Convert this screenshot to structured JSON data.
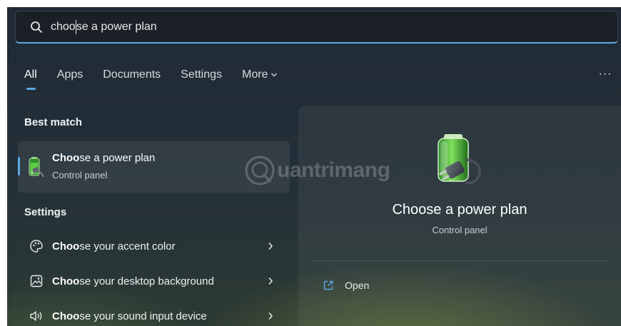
{
  "search": {
    "query_before_caret": "choo",
    "query_after_caret": "se a power plan"
  },
  "tabs": [
    {
      "label": "All",
      "active": true
    },
    {
      "label": "Apps"
    },
    {
      "label": "Documents"
    },
    {
      "label": "Settings"
    },
    {
      "label": "More"
    }
  ],
  "more_options_label": "···",
  "best_match": {
    "section_title": "Best match",
    "item": {
      "title_bold": "Choo",
      "title_rest": "se a power plan",
      "subtitle": "Control panel",
      "icon": "battery-plug-icon"
    }
  },
  "settings": {
    "section_title": "Settings",
    "items": [
      {
        "bold": "Choo",
        "rest": "se your accent color",
        "icon": "palette-icon"
      },
      {
        "bold": "Choo",
        "rest": "se your desktop background",
        "icon": "image-icon"
      },
      {
        "bold": "Choo",
        "rest": "se your sound input device",
        "icon": "speaker-icon"
      }
    ]
  },
  "detail": {
    "title": "Choose a power plan",
    "subtitle": "Control panel",
    "icon": "battery-plug-icon",
    "actions": [
      {
        "label": "Open",
        "icon": "open-external-icon"
      }
    ]
  },
  "watermark": {
    "text": "uantrimang"
  },
  "colors": {
    "accent": "#5aa9e6",
    "battery_green": "#3fb13a"
  }
}
